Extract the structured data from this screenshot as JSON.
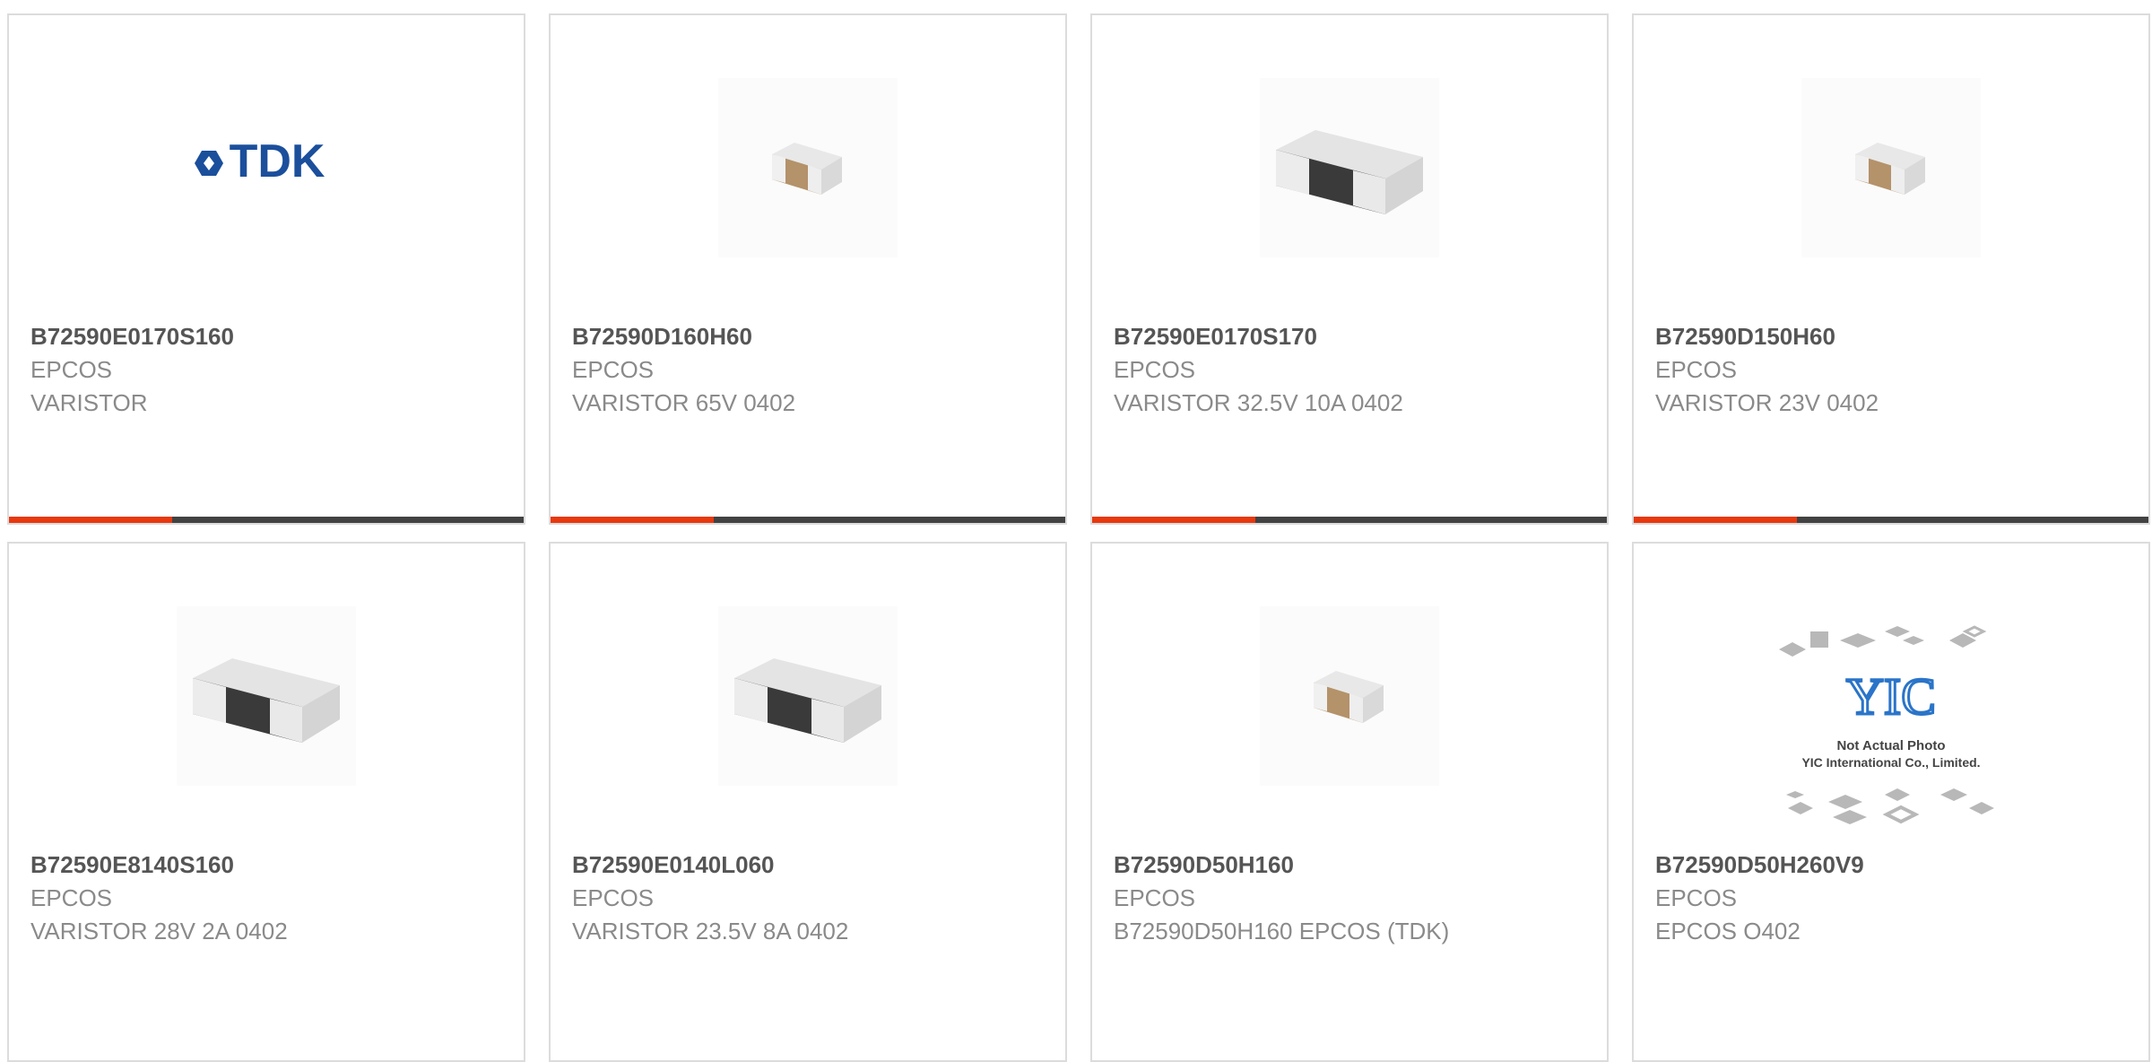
{
  "products": [
    {
      "part": "B72590E0170S160",
      "brand": "EPCOS",
      "desc": "VARISTOR",
      "image": "tdk-logo"
    },
    {
      "part": "B72590D160H60",
      "brand": "EPCOS",
      "desc": "VARISTOR 65V 0402",
      "image": "brown-chip-component"
    },
    {
      "part": "B72590E0170S170",
      "brand": "EPCOS",
      "desc": "VARISTOR 32.5V 10A 0402",
      "image": "black-chip-component"
    },
    {
      "part": "B72590D150H60",
      "brand": "EPCOS",
      "desc": "VARISTOR 23V 0402",
      "image": "brown-chip-component"
    },
    {
      "part": "B72590E8140S160",
      "brand": "EPCOS",
      "desc": "VARISTOR 28V 2A 0402",
      "image": "black-chip-component"
    },
    {
      "part": "B72590E0140L060",
      "brand": "EPCOS",
      "desc": "VARISTOR 23.5V 8A 0402",
      "image": "black-chip-component"
    },
    {
      "part": "B72590D50H160",
      "brand": "EPCOS",
      "desc": "B72590D50H160 EPCOS (TDK)",
      "image": "brown-chip-component"
    },
    {
      "part": "B72590D50H260V9",
      "brand": "EPCOS",
      "desc": "EPCOS O402",
      "image": "not-actual-photo-placeholder"
    }
  ],
  "logo": {
    "text": "TDK"
  },
  "placeholder": {
    "brand": "YIC",
    "line1": "Not Actual Photo",
    "line2": "YIC International Co., Limited."
  },
  "colors": {
    "accent": "#e8380d",
    "bar": "#424242",
    "border": "#dcdcdc",
    "tdk_blue": "#1b4f9c"
  }
}
